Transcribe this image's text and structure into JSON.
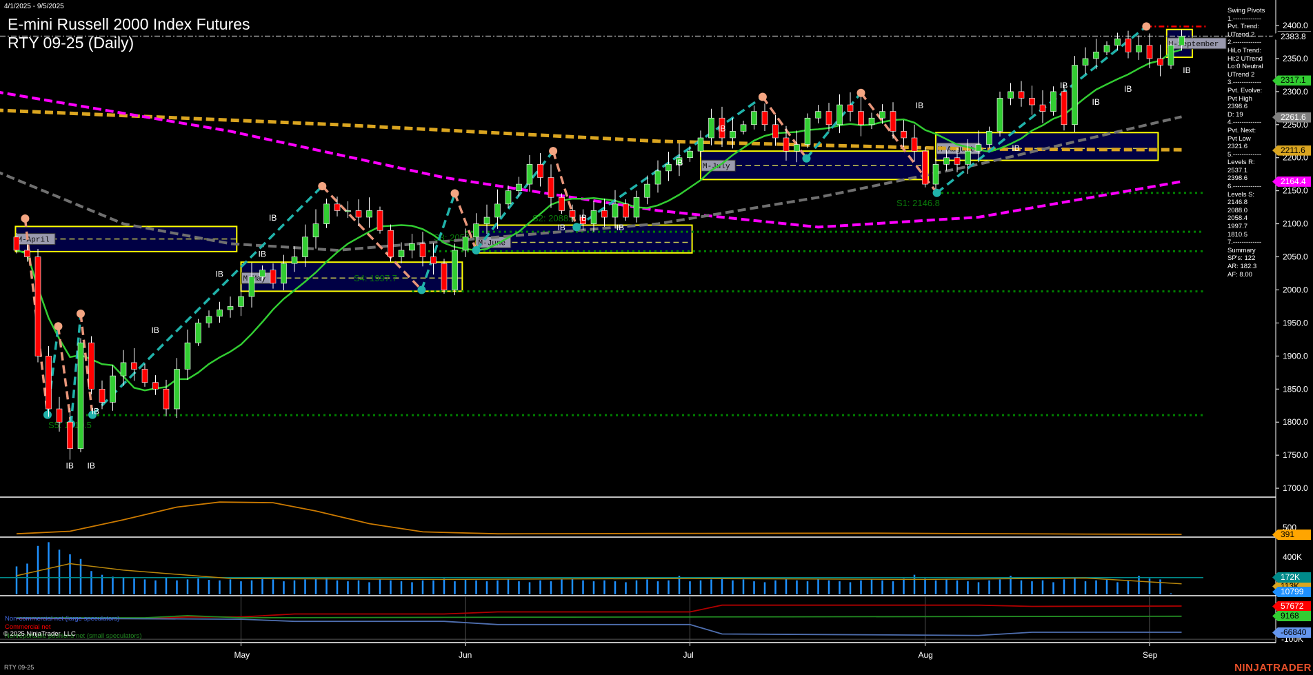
{
  "header": {
    "date_range": "4/1/2025 - 9/5/2025",
    "title": "E-mini Russell 2000 Index Futures",
    "subtitle": "RTY 09-25 (Daily)"
  },
  "info_panel": [
    "Swing Pivots",
    "1.-------------",
    "Pvt. Trend:",
    "UTrend 2",
    "2.-------------",
    "HiLo Trend:",
    "Hi:2 UTrend",
    "Lo:0 Neutral",
    "UTrend 2",
    "3.-------------",
    "Pvt. Evolve:",
    "Pvt High",
    "2398.6",
    "D: 19",
    "4.-------------",
    "Pvt. Next:",
    "Pvt Low",
    "2321.6",
    "5.-------------",
    "Levels R:",
    "2537.1",
    "2398.6",
    "6.-------------",
    "Levels S:",
    "2146.8",
    "2088.0",
    "2058.4",
    "1997.7",
    "1810.5",
    "7.-------------",
    "Summary",
    "SP's: 122",
    "AR: 182.3",
    "AF: 8.00"
  ],
  "price_tags": [
    {
      "value": "2383.8",
      "price": 2383.8,
      "bg": "#000000",
      "fg": "#ffffff"
    },
    {
      "value": "2317.1",
      "price": 2317.1,
      "bg": "#32cd32",
      "fg": "#000000"
    },
    {
      "value": "2261.6",
      "price": 2261.6,
      "bg": "#808080",
      "fg": "#ffffff"
    },
    {
      "value": "2211.6",
      "price": 2211.6,
      "bg": "#daa520",
      "fg": "#000000"
    },
    {
      "value": "2164.4",
      "price": 2164.4,
      "bg": "#ff00ff",
      "fg": "#ffffff"
    }
  ],
  "lower_tags": [
    {
      "value": "391",
      "panel": "osc",
      "bg": "#ffa500",
      "fg": "#000000"
    },
    {
      "value": "172K",
      "panel": "vol1",
      "bg": "#008b8b",
      "fg": "#ffffff"
    },
    {
      "value": "113K",
      "panel": "vol2",
      "bg": "#daa520",
      "fg": "#000000"
    },
    {
      "value": "10799",
      "panel": "vol3",
      "bg": "#1e90ff",
      "fg": "#ffffff"
    },
    {
      "value": "57672",
      "panel": "cot1",
      "bg": "#ff0000",
      "fg": "#ffffff"
    },
    {
      "value": "9168",
      "panel": "cot2",
      "bg": "#32cd32",
      "fg": "#000000"
    },
    {
      "value": "-66840",
      "panel": "cot3",
      "bg": "#6495ed",
      "fg": "#000000"
    }
  ],
  "lower_axis": {
    "osc_label": "500",
    "vol_label": "400K",
    "cot_label": "-100K"
  },
  "legend": {
    "noncommercial": "Non-commercial net (large speculators)",
    "commercial": "Commercial net",
    "nonreportable": "Nonreportable positions net (small speculators)",
    "copyright": "© 2025 NinjaTrader, LLC"
  },
  "footer": {
    "symbol": "RTY 09-25",
    "brand": "NINJATRADER"
  },
  "colors": {
    "up": "#32cd32",
    "down": "#ff0000",
    "box": "#ffff00",
    "box_fill": "#000044",
    "support": "#008000",
    "swing_up": "#20b2aa",
    "swing_down": "#e9967a"
  },
  "chart_data": {
    "type": "candlestick",
    "title": "E-mini Russell 2000 Index Futures RTY 09-25 (Daily)",
    "ylim": [
      1680,
      2420
    ],
    "y_ticks": [
      2400,
      2350,
      2300,
      2250,
      2200,
      2150,
      2100,
      2050,
      2000,
      1950,
      1900,
      1850,
      1800,
      1750,
      1700
    ],
    "x_ticks": [
      {
        "label": "May",
        "day": 21
      },
      {
        "label": "Jun",
        "day": 42
      },
      {
        "label": "Jul",
        "day": 63
      },
      {
        "label": "Aug",
        "day": 85
      },
      {
        "label": "Sep",
        "day": 106
      }
    ],
    "closes": [
      2060,
      2050,
      1900,
      1820,
      1800,
      1760,
      1920,
      1850,
      1830,
      1870,
      1890,
      1880,
      1860,
      1850,
      1820,
      1880,
      1920,
      1950,
      1960,
      1970,
      1975,
      1990,
      2020,
      2030,
      2010,
      2040,
      2050,
      2080,
      2100,
      2130,
      2120,
      2120,
      2110,
      2120,
      2090,
      2050,
      2060,
      2070,
      2050,
      2040,
      2000,
      2060,
      2080,
      2100,
      2110,
      2130,
      2150,
      2160,
      2190,
      2170,
      2140,
      2120,
      2110,
      2100,
      2120,
      2110,
      2130,
      2110,
      2140,
      2160,
      2180,
      2190,
      2200,
      2210,
      2230,
      2260,
      2230,
      2240,
      2250,
      2270,
      2250,
      2230,
      2210,
      2220,
      2260,
      2270,
      2250,
      2280,
      2270,
      2250,
      2260,
      2270,
      2240,
      2230,
      2210,
      2160,
      2190,
      2200,
      2190,
      2210,
      2220,
      2240,
      2290,
      2300,
      2290,
      2280,
      2270,
      2300,
      2250,
      2340,
      2350,
      2360,
      2370,
      2380,
      2360,
      2370,
      2350,
      2340,
      2370,
      2383.8
    ],
    "sma_fast_period": 10,
    "sma_gray": [
      [
        -2,
        2180
      ],
      [
        10,
        2100
      ],
      [
        20,
        2070
      ],
      [
        30,
        2060
      ],
      [
        45,
        2080
      ],
      [
        60,
        2100
      ],
      [
        75,
        2140
      ],
      [
        90,
        2190
      ],
      [
        109,
        2262
      ]
    ],
    "sma_orange": [
      [
        -2,
        2272
      ],
      [
        30,
        2250
      ],
      [
        60,
        2225
      ],
      [
        90,
        2213
      ],
      [
        109,
        2212
      ]
    ],
    "sma_magenta": [
      [
        -2,
        2300
      ],
      [
        20,
        2240
      ],
      [
        40,
        2170
      ],
      [
        60,
        2120
      ],
      [
        75,
        2095
      ],
      [
        90,
        2110
      ],
      [
        109,
        2164
      ]
    ],
    "swing_pivots": [
      [
        0.8,
        2108
      ],
      [
        2.9,
        1811
      ],
      [
        3.9,
        1945
      ],
      [
        5.1,
        1797
      ],
      [
        6.0,
        1964
      ],
      [
        7.1,
        1811
      ],
      [
        28.6,
        2157
      ],
      [
        37.9,
        2000
      ],
      [
        41,
        2146
      ],
      [
        43,
        2060
      ],
      [
        50.2,
        2210
      ],
      [
        52.4,
        2095
      ],
      [
        69.8,
        2292
      ],
      [
        73.9,
        2199
      ],
      [
        79,
        2298
      ],
      [
        86.1,
        2146.8
      ],
      [
        105.7,
        2398.6
      ]
    ],
    "monthly_boxes": [
      {
        "label": "M-April",
        "start": -0.1,
        "end": 20.6,
        "high": 2096,
        "low": 2058,
        "mid": 2077
      },
      {
        "label": "M-May",
        "start": 21,
        "end": 41.7,
        "high": 2042,
        "low": 1998,
        "mid": 2018
      },
      {
        "label": "M-June",
        "start": 43,
        "end": 63.2,
        "high": 2098,
        "low": 2056,
        "mid": 2072
      },
      {
        "label": "M-July",
        "start": 64,
        "end": 85.3,
        "high": 2210,
        "low": 2167,
        "mid": 2188
      },
      {
        "label": "M-August",
        "start": 86,
        "end": 106.8,
        "high": 2238,
        "low": 2196,
        "mid": 2214
      },
      {
        "label": "M-September",
        "start": 107.6,
        "end": 110,
        "high": 2394,
        "low": 2352,
        "mid": 2373
      }
    ],
    "supports": [
      {
        "label": "S1: 2146.8",
        "price": 2146.8,
        "from": 86
      },
      {
        "label": "S2: 2088.0",
        "price": 2088.0,
        "from": 42
      },
      {
        "label": "S3: 2058.4",
        "price": 2058.4,
        "from": 38
      },
      {
        "label": "S4: 1997.7",
        "price": 1997.7,
        "from": 37
      },
      {
        "label": "S5: 1810.5",
        "price": 1810.5,
        "from": 6
      }
    ],
    "last_price": 2383.8,
    "pivot_high": 2398.6,
    "ib_labels": [
      {
        "text": "IB",
        "day": 5,
        "price": 1730
      },
      {
        "text": "IB",
        "day": 7,
        "price": 1730
      },
      {
        "text": "IB",
        "day": 7.4,
        "price": 1812
      },
      {
        "text": "IB",
        "day": 13,
        "price": 1935
      },
      {
        "text": "IB",
        "day": 19,
        "price": 2020
      },
      {
        "text": "IB",
        "day": 23,
        "price": 2050
      },
      {
        "text": "IB",
        "day": 24,
        "price": 2105
      },
      {
        "text": "IB",
        "day": 51,
        "price": 2090
      },
      {
        "text": "IB",
        "day": 53,
        "price": 2105
      },
      {
        "text": "IB",
        "day": 56.5,
        "price": 2090
      },
      {
        "text": "IB",
        "day": 62,
        "price": 2188
      },
      {
        "text": "IB",
        "day": 66,
        "price": 2240
      },
      {
        "text": "IB",
        "day": 84.5,
        "price": 2275
      },
      {
        "text": "IB",
        "day": 93.5,
        "price": 2210
      },
      {
        "text": "IB",
        "day": 98,
        "price": 2305
      },
      {
        "text": "IB",
        "day": 101,
        "price": 2280
      },
      {
        "text": "IB",
        "day": 104,
        "price": 2300
      },
      {
        "text": "IB",
        "day": 109.5,
        "price": 2328
      }
    ],
    "oscillator": [
      [
        0,
        400
      ],
      [
        5,
        440
      ],
      [
        10,
        620
      ],
      [
        15,
        820
      ],
      [
        19,
        900
      ],
      [
        24,
        890
      ],
      [
        28,
        760
      ],
      [
        33,
        560
      ],
      [
        38,
        430
      ],
      [
        45,
        400
      ],
      [
        60,
        405
      ],
      [
        80,
        410
      ],
      [
        100,
        395
      ],
      [
        109,
        391
      ]
    ],
    "volume_k": [
      300,
      330,
      520,
      560,
      480,
      430,
      380,
      250,
      210,
      190,
      180,
      170,
      160,
      150,
      175,
      150,
      160,
      170,
      155,
      150,
      160,
      140,
      150,
      170,
      160,
      140,
      150,
      160,
      170,
      180,
      150,
      140,
      150,
      130,
      160,
      150,
      140,
      130,
      150,
      150,
      170,
      140,
      160,
      150,
      140,
      150,
      160,
      140,
      130,
      150,
      140,
      160,
      170,
      150,
      140,
      150,
      140,
      130,
      150,
      160,
      140,
      150,
      200,
      140,
      150,
      160,
      170,
      150,
      160,
      140,
      130,
      150,
      170,
      150,
      140,
      160,
      150,
      140,
      130,
      150,
      160,
      150,
      140,
      170,
      210,
      170,
      150,
      160,
      150,
      140,
      130,
      150,
      160,
      200,
      150,
      140,
      150,
      130,
      160,
      170,
      140,
      150,
      160,
      130,
      150,
      200,
      170,
      160,
      10.8
    ],
    "volume_avg_k": [
      [
        0,
        200
      ],
      [
        5,
        330
      ],
      [
        10,
        260
      ],
      [
        20,
        170
      ],
      [
        40,
        160
      ],
      [
        63,
        170
      ],
      [
        85,
        160
      ],
      [
        100,
        175
      ],
      [
        109,
        113
      ]
    ],
    "cot": {
      "commercial": [
        [
          0,
          -2000
        ],
        [
          12,
          -2000
        ],
        [
          16,
          6000
        ],
        [
          21,
          6000
        ],
        [
          26,
          20000
        ],
        [
          40,
          20000
        ],
        [
          45,
          30000
        ],
        [
          63,
          30000
        ],
        [
          66,
          62000
        ],
        [
          90,
          62000
        ],
        [
          95,
          56000
        ],
        [
          109,
          57672
        ]
      ],
      "nonreportable": [
        [
          0,
          2000
        ],
        [
          12,
          2000
        ],
        [
          16,
          12000
        ],
        [
          21,
          2000
        ],
        [
          40,
          4000
        ],
        [
          63,
          6000
        ],
        [
          90,
          8000
        ],
        [
          109,
          9168
        ]
      ],
      "noncommercial": [
        [
          0,
          0
        ],
        [
          21,
          -5000
        ],
        [
          26,
          -15000
        ],
        [
          40,
          -15000
        ],
        [
          45,
          -30000
        ],
        [
          63,
          -30000
        ],
        [
          66,
          -75000
        ],
        [
          90,
          -82000
        ],
        [
          95,
          -66840
        ],
        [
          109,
          -66840
        ]
      ]
    }
  }
}
